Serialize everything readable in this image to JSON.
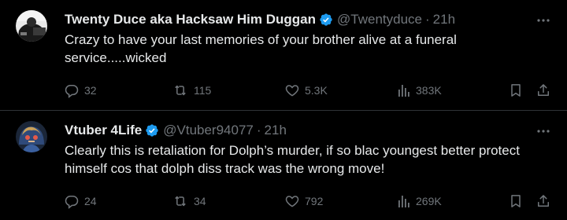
{
  "tweets": [
    {
      "name": "Twenty Duce aka Hacksaw Him Duggan",
      "handle": "@Twentyduce",
      "separator": "·",
      "time": "21h",
      "text": "Crazy to have your last memories of your brother alive at a funeral service.....wicked",
      "replies": "32",
      "retweets": "115",
      "likes": "5.3K",
      "views": "383K"
    },
    {
      "name": "Vtuber 4Life",
      "handle": "@Vtuber94077",
      "separator": "·",
      "time": "21h",
      "text": "Clearly this is retaliation for Dolph’s murder, if so blac youngest better protect himself cos that dolph diss track was the wrong move!",
      "replies": "24",
      "retweets": "34",
      "likes": "792",
      "views": "269K"
    }
  ],
  "icons": {
    "verified": "verified-badge-icon",
    "more": "more-horizontal-icon",
    "reply": "reply-bubble-icon",
    "retweet": "retweet-icon",
    "like": "heart-icon",
    "views": "views-bars-icon",
    "bookmark": "bookmark-icon",
    "share": "share-icon"
  },
  "colors": {
    "background": "#000000",
    "text": "#e7e9ea",
    "secondary": "#71767b",
    "verified": "#1d9bf0",
    "divider": "#2f3336"
  }
}
